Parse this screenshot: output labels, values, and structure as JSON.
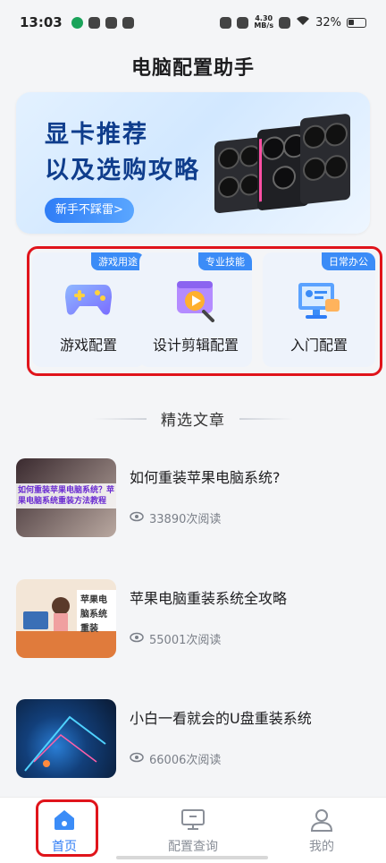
{
  "status_bar": {
    "time": "13:03",
    "net_speed_top": "4.30",
    "net_speed_bottom": "MB/s",
    "battery": "32%"
  },
  "app": {
    "title": "电脑配置助手"
  },
  "banner": {
    "line1": "显卡推荐",
    "line2": "以及选购攻略",
    "cta": "新手不踩雷>"
  },
  "categories": [
    {
      "tag": "游戏用途",
      "label": "游戏配置",
      "icon": "gamepad-icon"
    },
    {
      "tag": "专业技能",
      "label": "设计剪辑配置",
      "icon": "video-edit-icon"
    },
    {
      "tag": "日常办公",
      "label": "入门配置",
      "icon": "office-computer-icon"
    }
  ],
  "section": {
    "title": "精选文章"
  },
  "articles": [
    {
      "title": "如何重装苹果电脑系统?",
      "reads": "33890次阅读",
      "thumb_caption": "如何重装苹果电脑系统？苹果电脑系统重装方法教程"
    },
    {
      "title": "苹果电脑重装系统全攻略",
      "reads": "55001次阅读",
      "thumb_caption": "苹果电脑系统重装"
    },
    {
      "title": "小白一看就会的U盘重装系统",
      "reads": "66006次阅读"
    }
  ],
  "bottom_nav": [
    {
      "label": "首页",
      "icon": "home-icon",
      "active": true
    },
    {
      "label": "配置查询",
      "icon": "monitor-icon",
      "active": false
    },
    {
      "label": "我的",
      "icon": "user-icon",
      "active": false
    }
  ],
  "colors": {
    "accent": "#2f7df6",
    "highlight_border": "#e0141b",
    "banner_text": "#0f3d8c"
  }
}
